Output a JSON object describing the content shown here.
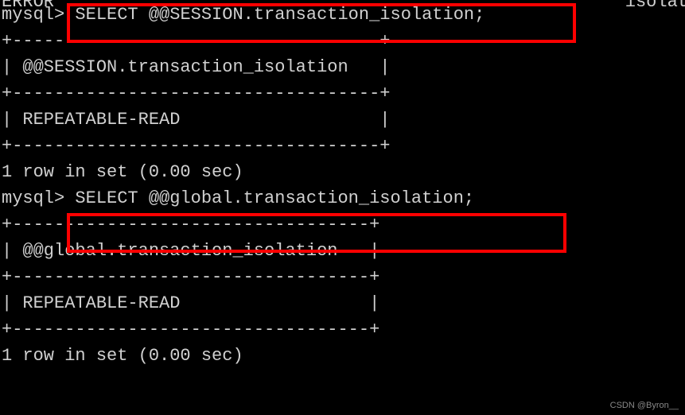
{
  "error_fragment": "ERROR",
  "top_right_fragment": "isolat",
  "query1": {
    "prompt": "mysql>",
    "sql": " SELECT @@SESSION.transaction_isolation;",
    "border_top": "+-----------------------------------+",
    "header_row": "| @@SESSION.transaction_isolation   |",
    "border_mid": "+-----------------------------------+",
    "value_row": "| REPEATABLE-READ                   |",
    "border_bot": "+-----------------------------------+",
    "result": "1 row in set (0.00 sec)"
  },
  "blank": "",
  "query2": {
    "prompt": "mysql>",
    "sql": " SELECT @@global.transaction_isolation;",
    "border_top": "+----------------------------------+",
    "header_row": "| @@global.transaction_isolation   |",
    "border_mid": "+----------------------------------+",
    "value_row": "| REPEATABLE-READ                  |",
    "border_bot": "+----------------------------------+",
    "result": "1 row in set (0.00 sec)"
  },
  "watermark": "CSDN @Byron__"
}
